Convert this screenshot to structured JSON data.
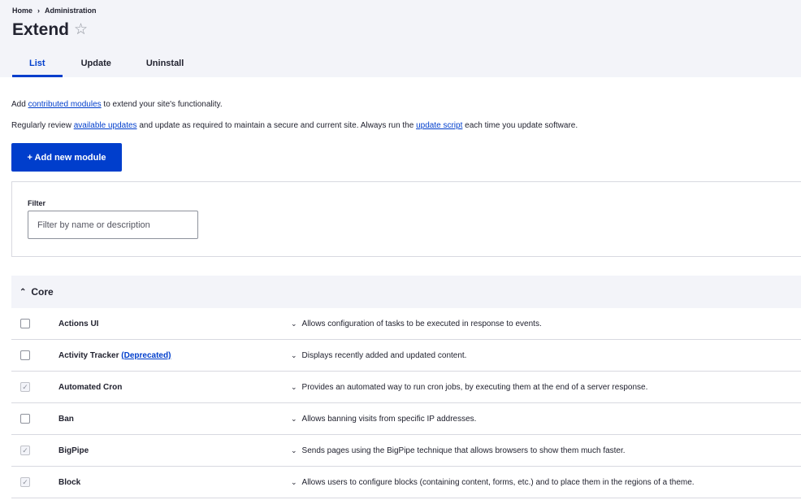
{
  "breadcrumb": {
    "home": "Home",
    "separator": "›",
    "current": "Administration"
  },
  "page": {
    "title": "Extend",
    "star_icon": "☆"
  },
  "tabs": [
    {
      "label": "List",
      "active": true
    },
    {
      "label": "Update",
      "active": false
    },
    {
      "label": "Uninstall",
      "active": false
    }
  ],
  "intro": {
    "line1": {
      "before": "Add ",
      "link": "contributed modules",
      "after": " to extend your site's functionality."
    },
    "line2": {
      "before": "Regularly review ",
      "link1": "available updates",
      "middle": " and update as required to maintain a secure and current site. Always run the ",
      "link2": "update script",
      "after": " each time you update software."
    }
  },
  "add_button": {
    "label": "+ Add new module"
  },
  "filter": {
    "label": "Filter",
    "placeholder": "Filter by name or description",
    "value": ""
  },
  "core": {
    "chevron": "⌃",
    "label": "Core"
  },
  "modules": [
    {
      "name": "Actions UI",
      "tag": "",
      "checked": false,
      "description": "Allows configuration of tasks to be executed in response to events."
    },
    {
      "name": "Activity Tracker",
      "tag": "(Deprecated)",
      "checked": false,
      "description": "Displays recently added and updated content."
    },
    {
      "name": "Automated Cron",
      "tag": "",
      "checked": true,
      "description": "Provides an automated way to run cron jobs, by executing them at the end of a server response."
    },
    {
      "name": "Ban",
      "tag": "",
      "checked": false,
      "description": "Allows banning visits from specific IP addresses."
    },
    {
      "name": "BigPipe",
      "tag": "",
      "checked": true,
      "description": "Sends pages using the BigPipe technique that allows browsers to show them much faster."
    },
    {
      "name": "Block",
      "tag": "",
      "checked": true,
      "description": "Allows users to configure blocks (containing content, forms, etc.) and to place them in the regions of a theme."
    }
  ],
  "icons": {
    "desc_chevron": "⌄",
    "check": "✓"
  },
  "colors": {
    "accent": "#003ecc",
    "header_bg": "#f3f4f9",
    "border": "#d8d9e0"
  }
}
